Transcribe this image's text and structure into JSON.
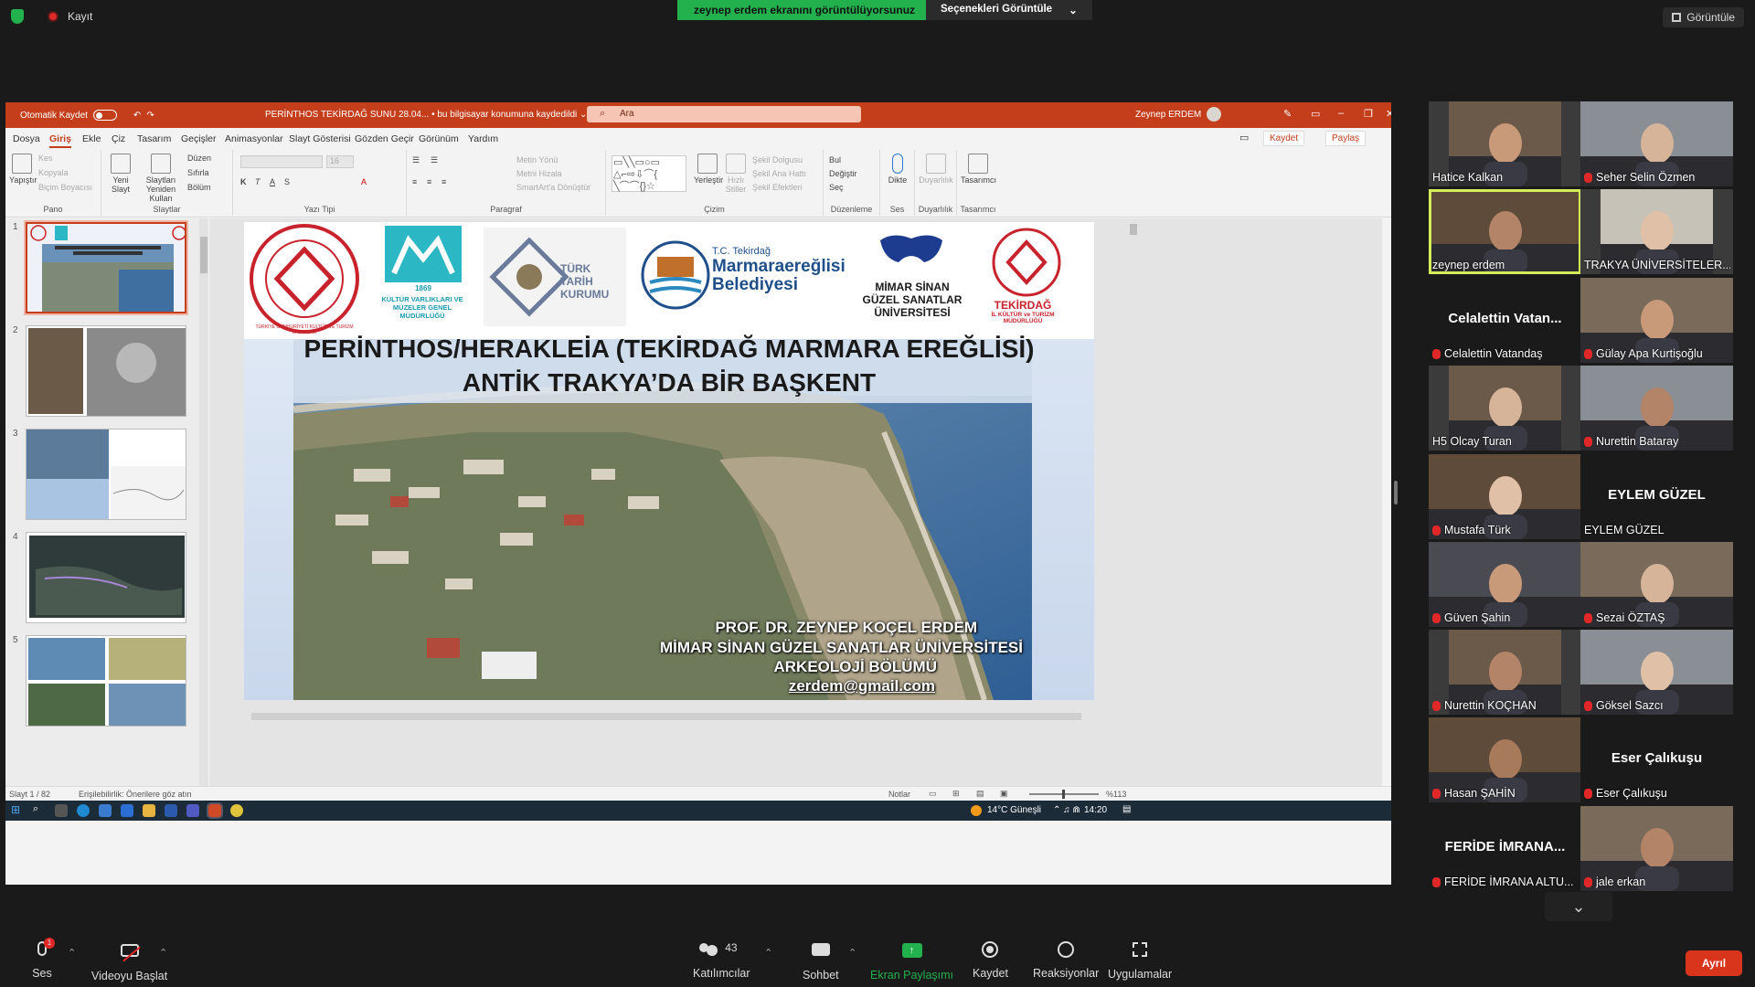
{
  "zoom": {
    "recording_label": "Kayıt",
    "share_banner": "zeynep erdem ekranını görüntülüyorsunuz",
    "view_options": "Seçenekleri Görüntüle",
    "view_options_caret": "⌄",
    "gallery_view": "Görüntüle",
    "bottom": {
      "audio": "Ses",
      "video": "Videoyu Başlat",
      "participants": "Katılımcılar",
      "participants_count": "43",
      "chat": "Sohbet",
      "share": "Ekran Paylaşımı",
      "record": "Kaydet",
      "reactions": "Reaksiyonlar",
      "apps": "Uygulamalar",
      "leave": "Ayrıl",
      "audio_badge": "1"
    },
    "participants_list": [
      {
        "name": "Hatice Kalkan",
        "muted": false,
        "video": true
      },
      {
        "name": "Seher Selin Özmen",
        "muted": true,
        "video": true
      },
      {
        "name": "zeynep erdem",
        "muted": false,
        "video": true,
        "active": true
      },
      {
        "name": "TRAKYA ÜNİVERSİTELER...",
        "muted": false,
        "video": true
      },
      {
        "name": "Celalettin Vatandaş",
        "muted": true,
        "video": false,
        "display": "Celalettin  Vatan..."
      },
      {
        "name": "Gülay Apa Kurtişoğlu",
        "muted": true,
        "video": true
      },
      {
        "name": "H5 Olcay Turan",
        "muted": false,
        "video": true
      },
      {
        "name": "Nurettin Bataray",
        "muted": true,
        "video": true
      },
      {
        "name": "Mustafa Türk",
        "muted": true,
        "video": true
      },
      {
        "name": "EYLEM GÜZEL",
        "muted": false,
        "video": false,
        "display": "EYLEM GÜZEL"
      },
      {
        "name": "Güven Şahin",
        "muted": true,
        "video": true
      },
      {
        "name": "Sezai ÖZTAŞ",
        "muted": true,
        "video": true
      },
      {
        "name": "Nurettin KOÇHAN",
        "muted": true,
        "video": true
      },
      {
        "name": "Göksel Sazcı",
        "muted": true,
        "video": true
      },
      {
        "name": "Hasan ŞAHİN",
        "muted": true,
        "video": true
      },
      {
        "name": "Eser Çalıkuşu",
        "muted": true,
        "video": false,
        "display": "Eser Çalıkuşu"
      },
      {
        "name": "FERİDE İMRANA ALTU...",
        "muted": true,
        "video": false,
        "display": "FERİDE İMRANA..."
      },
      {
        "name": "jale erkan",
        "muted": true,
        "video": true
      }
    ]
  },
  "ppt": {
    "autosave": "Otomatik Kaydet",
    "doc_title": "PERİNTHOS TEKİRDAĞ SUNU 28.04...  •  bu bilgisayar konumuna kaydedildi ⌄",
    "search_placeholder": "Ara",
    "user": "Zeynep ERDEM",
    "menu": [
      "Dosya",
      "Giriş",
      "Ekle",
      "Çiz",
      "Tasarım",
      "Geçişler",
      "Animasyonlar",
      "Slayt Gösterisi",
      "Gözden Geçir",
      "Görünüm",
      "Yardım"
    ],
    "save": "Kaydet",
    "share": "Paylaş",
    "ribbon": {
      "groups": [
        "Pano",
        "Slaytlar",
        "Yazı Tipi",
        "Paragraf",
        "Çizim",
        "Düzenleme",
        "Ses",
        "Duyarlılık",
        "Tasarımcı"
      ],
      "paste": "Yapıştır",
      "cut": "Kes",
      "copy": "Kopyala",
      "format_painter": "Biçim Boyacısı",
      "new_slide": "Yeni Slayt",
      "reuse": "Slaytları Yeniden Kullan",
      "layout": "Düzen",
      "reset": "Sıfırla",
      "section": "Bölüm",
      "font_size": "16",
      "text_direction": "Metin Yönü",
      "align_text": "Metni Hizala",
      "smartart": "SmartArt'a Dönüştür",
      "arrange": "Yerleştir",
      "quick_styles": "Hızlı Stiller",
      "shape_fill": "Şekil Dolgusu",
      "shape_outline": "Şekil Ana Hattı",
      "shape_effects": "Şekil Efektleri",
      "find": "Bul",
      "replace": "Değiştir",
      "select": "Seç",
      "dictate": "Dikte",
      "sensitivity": "Duyarlılık",
      "designer": "Tasarımcı"
    },
    "slide_numbers": [
      "1",
      "2",
      "3",
      "4",
      "5"
    ],
    "slide": {
      "title_line1": "PERİNTHOS/HERAKLEİA (TEKİRDAĞ MARMARA EREĞLİSİ)",
      "title_line2": "ANTİK TRAKYA’DA BİR BAŞKENT",
      "author": "PROF. DR. ZEYNEP KOÇEL ERDEM",
      "university": "MİMAR SİNAN GÜZEL SANATLAR ÜNİVERSİTESİ",
      "department": "ARKEOLOJİ BÖLÜMÜ",
      "email": "zerdem@gmail.com",
      "logos": {
        "ministry": "TÜRKİYE CUMHURİYETİ KÜLTÜR VE TURİZM BAKANLIĞI",
        "kvmgm_year": "1869",
        "kvmgm": "KÜLTÜR VARLIKLARI VE MÜZELER GENEL MÜDÜRLÜĞÜ",
        "ttk": "TÜRK TARİH KURUMU",
        "tc_tekirdag": "T.C. Tekirdağ",
        "belediye1": "Marmaraereğlisi",
        "belediye2": "Belediyesi",
        "msgsu1": "MİMAR SİNAN",
        "msgsu2": "GÜZEL SANATLAR",
        "msgsu3": "ÜNİVERSİTESİ",
        "tekirdag1": "TEKİRDAĞ",
        "tekirdag2": "İL KÜLTÜR ve TURİZM MÜDÜRLÜĞÜ"
      }
    },
    "status": {
      "slide": "Slayt 1 / 82",
      "accessibility": "Erişilebilirlik: Önerilere göz atın",
      "notes": "Notlar",
      "zoom": "%113"
    },
    "taskbar": {
      "weather": "14°C  Güneşli",
      "time": "14:20"
    }
  }
}
